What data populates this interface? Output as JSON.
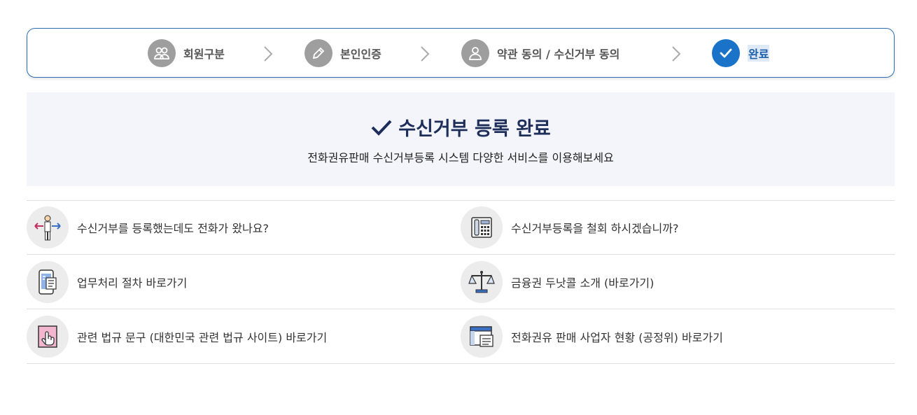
{
  "steps": [
    {
      "label": "회원구분",
      "icon": "group-icon",
      "active": false
    },
    {
      "label": "본인인증",
      "icon": "pencil-icon",
      "active": false
    },
    {
      "label": "약관 동의 / 수신거부 동의",
      "icon": "user-icon",
      "active": false
    },
    {
      "label": "완료",
      "icon": "check-icon",
      "active": true
    }
  ],
  "banner": {
    "title": "수신거부 등록 완료",
    "subtitle": "전화권유판매 수신거부등록 시스템 다양한 서비스를 이용해보세요"
  },
  "links": [
    {
      "label": "수신거부를 등록했는데도 전화가 왔나요?",
      "icon": "person-arrows-icon"
    },
    {
      "label": "수신거부등록을 철회 하시겠습니까?",
      "icon": "telephone-icon"
    },
    {
      "label": "업무처리 절차 바로가기",
      "icon": "mobile-document-icon"
    },
    {
      "label": "금융권 두낫콜 소개 (바로가기)",
      "icon": "scale-icon"
    },
    {
      "label": "관련 법규 문구 (대한민국 관련 법규 사이트) 바로가기",
      "icon": "hand-click-icon"
    },
    {
      "label": "전화권유 판매 사업자 현황 (공정위) 바로가기",
      "icon": "window-document-icon"
    }
  ],
  "colors": {
    "accent": "#1a73c9",
    "border": "#2f6fb0",
    "title": "#1e2e5a",
    "inactive_step": "#9e9e9e"
  }
}
